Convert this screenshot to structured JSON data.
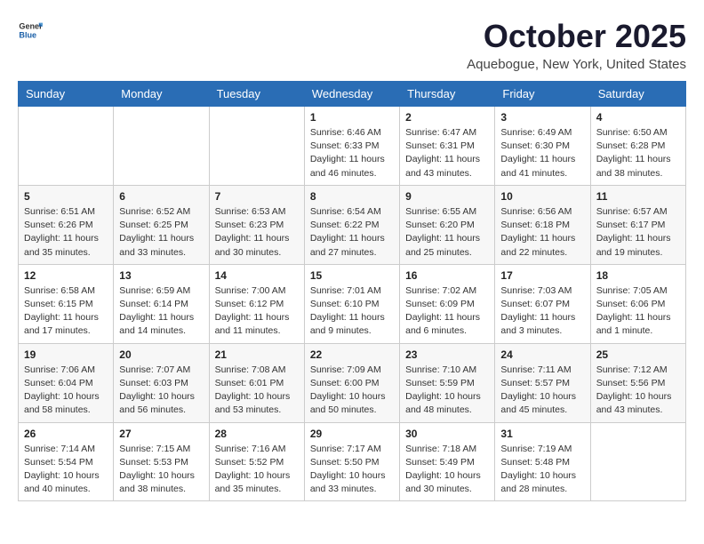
{
  "logo": {
    "general": "General",
    "blue": "Blue"
  },
  "title": "October 2025",
  "location": "Aquebogue, New York, United States",
  "days_of_week": [
    "Sunday",
    "Monday",
    "Tuesday",
    "Wednesday",
    "Thursday",
    "Friday",
    "Saturday"
  ],
  "weeks": [
    [
      {
        "day": "",
        "info": ""
      },
      {
        "day": "",
        "info": ""
      },
      {
        "day": "",
        "info": ""
      },
      {
        "day": "1",
        "info": "Sunrise: 6:46 AM\nSunset: 6:33 PM\nDaylight: 11 hours and 46 minutes."
      },
      {
        "day": "2",
        "info": "Sunrise: 6:47 AM\nSunset: 6:31 PM\nDaylight: 11 hours and 43 minutes."
      },
      {
        "day": "3",
        "info": "Sunrise: 6:49 AM\nSunset: 6:30 PM\nDaylight: 11 hours and 41 minutes."
      },
      {
        "day": "4",
        "info": "Sunrise: 6:50 AM\nSunset: 6:28 PM\nDaylight: 11 hours and 38 minutes."
      }
    ],
    [
      {
        "day": "5",
        "info": "Sunrise: 6:51 AM\nSunset: 6:26 PM\nDaylight: 11 hours and 35 minutes."
      },
      {
        "day": "6",
        "info": "Sunrise: 6:52 AM\nSunset: 6:25 PM\nDaylight: 11 hours and 33 minutes."
      },
      {
        "day": "7",
        "info": "Sunrise: 6:53 AM\nSunset: 6:23 PM\nDaylight: 11 hours and 30 minutes."
      },
      {
        "day": "8",
        "info": "Sunrise: 6:54 AM\nSunset: 6:22 PM\nDaylight: 11 hours and 27 minutes."
      },
      {
        "day": "9",
        "info": "Sunrise: 6:55 AM\nSunset: 6:20 PM\nDaylight: 11 hours and 25 minutes."
      },
      {
        "day": "10",
        "info": "Sunrise: 6:56 AM\nSunset: 6:18 PM\nDaylight: 11 hours and 22 minutes."
      },
      {
        "day": "11",
        "info": "Sunrise: 6:57 AM\nSunset: 6:17 PM\nDaylight: 11 hours and 19 minutes."
      }
    ],
    [
      {
        "day": "12",
        "info": "Sunrise: 6:58 AM\nSunset: 6:15 PM\nDaylight: 11 hours and 17 minutes."
      },
      {
        "day": "13",
        "info": "Sunrise: 6:59 AM\nSunset: 6:14 PM\nDaylight: 11 hours and 14 minutes."
      },
      {
        "day": "14",
        "info": "Sunrise: 7:00 AM\nSunset: 6:12 PM\nDaylight: 11 hours and 11 minutes."
      },
      {
        "day": "15",
        "info": "Sunrise: 7:01 AM\nSunset: 6:10 PM\nDaylight: 11 hours and 9 minutes."
      },
      {
        "day": "16",
        "info": "Sunrise: 7:02 AM\nSunset: 6:09 PM\nDaylight: 11 hours and 6 minutes."
      },
      {
        "day": "17",
        "info": "Sunrise: 7:03 AM\nSunset: 6:07 PM\nDaylight: 11 hours and 3 minutes."
      },
      {
        "day": "18",
        "info": "Sunrise: 7:05 AM\nSunset: 6:06 PM\nDaylight: 11 hours and 1 minute."
      }
    ],
    [
      {
        "day": "19",
        "info": "Sunrise: 7:06 AM\nSunset: 6:04 PM\nDaylight: 10 hours and 58 minutes."
      },
      {
        "day": "20",
        "info": "Sunrise: 7:07 AM\nSunset: 6:03 PM\nDaylight: 10 hours and 56 minutes."
      },
      {
        "day": "21",
        "info": "Sunrise: 7:08 AM\nSunset: 6:01 PM\nDaylight: 10 hours and 53 minutes."
      },
      {
        "day": "22",
        "info": "Sunrise: 7:09 AM\nSunset: 6:00 PM\nDaylight: 10 hours and 50 minutes."
      },
      {
        "day": "23",
        "info": "Sunrise: 7:10 AM\nSunset: 5:59 PM\nDaylight: 10 hours and 48 minutes."
      },
      {
        "day": "24",
        "info": "Sunrise: 7:11 AM\nSunset: 5:57 PM\nDaylight: 10 hours and 45 minutes."
      },
      {
        "day": "25",
        "info": "Sunrise: 7:12 AM\nSunset: 5:56 PM\nDaylight: 10 hours and 43 minutes."
      }
    ],
    [
      {
        "day": "26",
        "info": "Sunrise: 7:14 AM\nSunset: 5:54 PM\nDaylight: 10 hours and 40 minutes."
      },
      {
        "day": "27",
        "info": "Sunrise: 7:15 AM\nSunset: 5:53 PM\nDaylight: 10 hours and 38 minutes."
      },
      {
        "day": "28",
        "info": "Sunrise: 7:16 AM\nSunset: 5:52 PM\nDaylight: 10 hours and 35 minutes."
      },
      {
        "day": "29",
        "info": "Sunrise: 7:17 AM\nSunset: 5:50 PM\nDaylight: 10 hours and 33 minutes."
      },
      {
        "day": "30",
        "info": "Sunrise: 7:18 AM\nSunset: 5:49 PM\nDaylight: 10 hours and 30 minutes."
      },
      {
        "day": "31",
        "info": "Sunrise: 7:19 AM\nSunset: 5:48 PM\nDaylight: 10 hours and 28 minutes."
      },
      {
        "day": "",
        "info": ""
      }
    ]
  ]
}
